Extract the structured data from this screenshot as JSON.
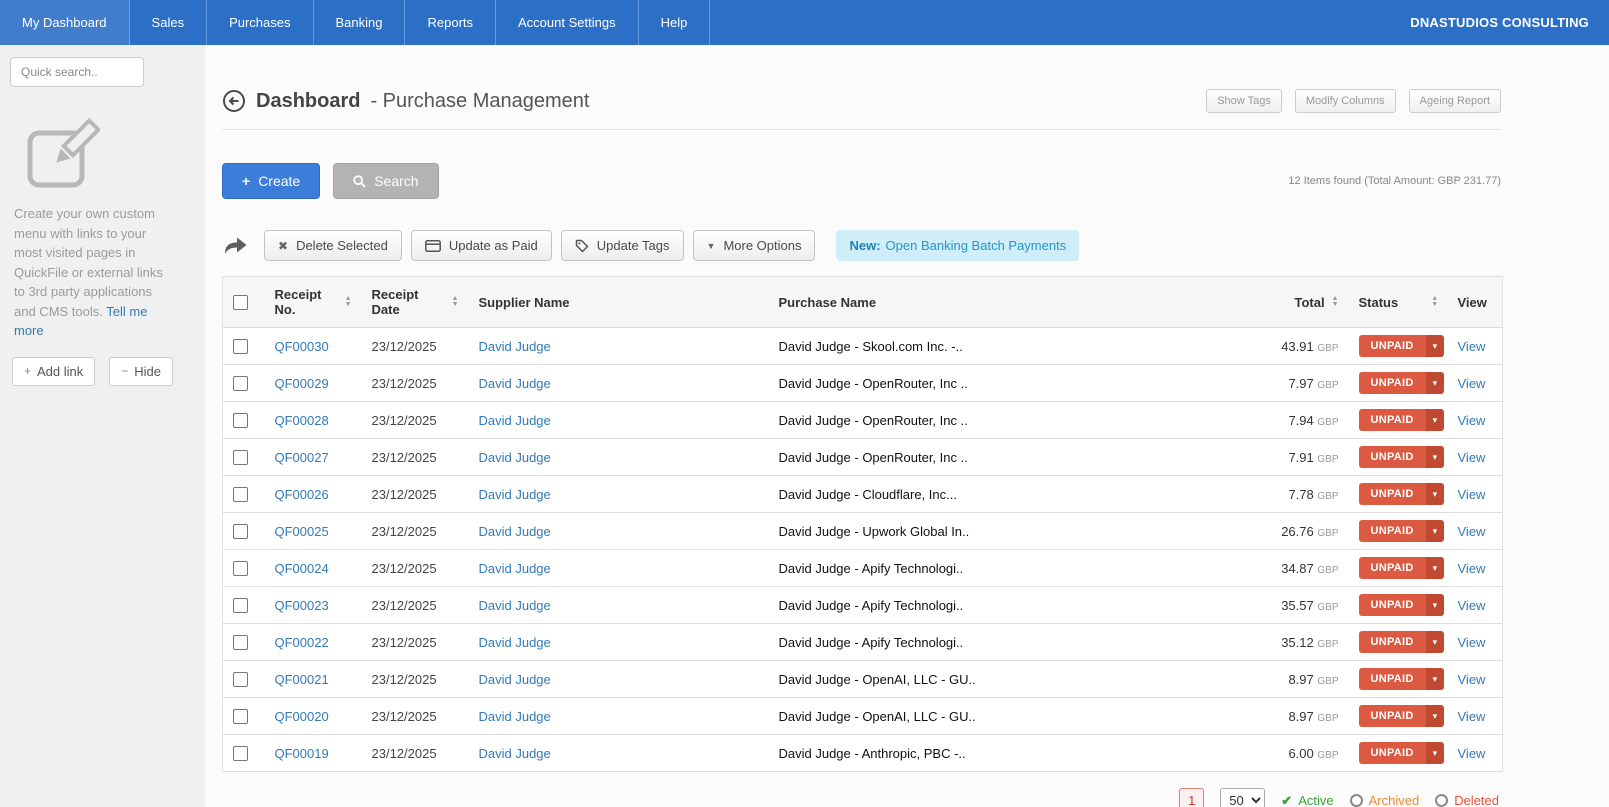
{
  "nav": {
    "items": [
      {
        "label": "My Dashboard",
        "active": true
      },
      {
        "label": "Sales",
        "active": false
      },
      {
        "label": "Purchases",
        "active": false
      },
      {
        "label": "Banking",
        "active": false
      },
      {
        "label": "Reports",
        "active": false
      },
      {
        "label": "Account Settings",
        "active": false
      },
      {
        "label": "Help",
        "active": false
      }
    ],
    "company": "DNASTUDIOS CONSULTING"
  },
  "sidebar": {
    "search_placeholder": "Quick search..",
    "promo_text": "Create your own custom menu with links to your most visited pages in QuickFile or external links to 3rd party applications and CMS tools. ",
    "promo_link": "Tell me more",
    "add_link_label": "Add link",
    "hide_label": "Hide"
  },
  "header": {
    "title": "Dashboard",
    "subtitle": "- Purchase Management",
    "actions": [
      "Show Tags",
      "Modify Columns",
      "Ageing Report"
    ]
  },
  "actions": {
    "create_label": "Create",
    "search_label": "Search",
    "items_found": "12 Items found (Total Amount: GBP 231.77)"
  },
  "toolbar": {
    "delete_selected": "Delete Selected",
    "update_as_paid": "Update as Paid",
    "update_tags": "Update Tags",
    "more_options": "More Options",
    "new_prefix": "New:",
    "new_text": "Open Banking Batch Payments"
  },
  "icons": {
    "plus": "+",
    "minus": "−",
    "x": "✖",
    "caret_down": "▼",
    "caret_down_small": "▾",
    "check": "✔"
  },
  "table": {
    "headers": {
      "receipt_no": "Receipt No.",
      "receipt_date": "Receipt Date",
      "supplier_name": "Supplier Name",
      "purchase_name": "Purchase Name",
      "total": "Total",
      "status": "Status",
      "view": "View"
    },
    "rows": [
      {
        "receipt_no": "QF00030",
        "date": "23/12/2025",
        "supplier": "David Judge",
        "purchase": "David Judge - Skool.com Inc. -..",
        "total": "43.91",
        "currency": "GBP",
        "status": "UNPAID",
        "view": "View"
      },
      {
        "receipt_no": "QF00029",
        "date": "23/12/2025",
        "supplier": "David Judge",
        "purchase": "David Judge - OpenRouter, Inc ..",
        "total": "7.97",
        "currency": "GBP",
        "status": "UNPAID",
        "view": "View"
      },
      {
        "receipt_no": "QF00028",
        "date": "23/12/2025",
        "supplier": "David Judge",
        "purchase": "David Judge - OpenRouter, Inc ..",
        "total": "7.94",
        "currency": "GBP",
        "status": "UNPAID",
        "view": "View"
      },
      {
        "receipt_no": "QF00027",
        "date": "23/12/2025",
        "supplier": "David Judge",
        "purchase": "David Judge - OpenRouter, Inc ..",
        "total": "7.91",
        "currency": "GBP",
        "status": "UNPAID",
        "view": "View"
      },
      {
        "receipt_no": "QF00026",
        "date": "23/12/2025",
        "supplier": "David Judge",
        "purchase": "David Judge - Cloudflare, Inc...",
        "total": "7.78",
        "currency": "GBP",
        "status": "UNPAID",
        "view": "View"
      },
      {
        "receipt_no": "QF00025",
        "date": "23/12/2025",
        "supplier": "David Judge",
        "purchase": "David Judge - Upwork Global In..",
        "total": "26.76",
        "currency": "GBP",
        "status": "UNPAID",
        "view": "View"
      },
      {
        "receipt_no": "QF00024",
        "date": "23/12/2025",
        "supplier": "David Judge",
        "purchase": "David Judge - Apify Technologi..",
        "total": "34.87",
        "currency": "GBP",
        "status": "UNPAID",
        "view": "View"
      },
      {
        "receipt_no": "QF00023",
        "date": "23/12/2025",
        "supplier": "David Judge",
        "purchase": "David Judge - Apify Technologi..",
        "total": "35.57",
        "currency": "GBP",
        "status": "UNPAID",
        "view": "View"
      },
      {
        "receipt_no": "QF00022",
        "date": "23/12/2025",
        "supplier": "David Judge",
        "purchase": "David Judge - Apify Technologi..",
        "total": "35.12",
        "currency": "GBP",
        "status": "UNPAID",
        "view": "View"
      },
      {
        "receipt_no": "QF00021",
        "date": "23/12/2025",
        "supplier": "David Judge",
        "purchase": "David Judge - OpenAI, LLC - GU..",
        "total": "8.97",
        "currency": "GBP",
        "status": "UNPAID",
        "view": "View"
      },
      {
        "receipt_no": "QF00020",
        "date": "23/12/2025",
        "supplier": "David Judge",
        "purchase": "David Judge - OpenAI, LLC - GU..",
        "total": "8.97",
        "currency": "GBP",
        "status": "UNPAID",
        "view": "View"
      },
      {
        "receipt_no": "QF00019",
        "date": "23/12/2025",
        "supplier": "David Judge",
        "purchase": "David Judge - Anthropic, PBC -..",
        "total": "6.00",
        "currency": "GBP",
        "status": "UNPAID",
        "view": "View"
      }
    ]
  },
  "footer": {
    "page": "1",
    "page_size": "50",
    "filter_active": "Active",
    "filter_archived": "Archived",
    "filter_deleted": "Deleted"
  }
}
